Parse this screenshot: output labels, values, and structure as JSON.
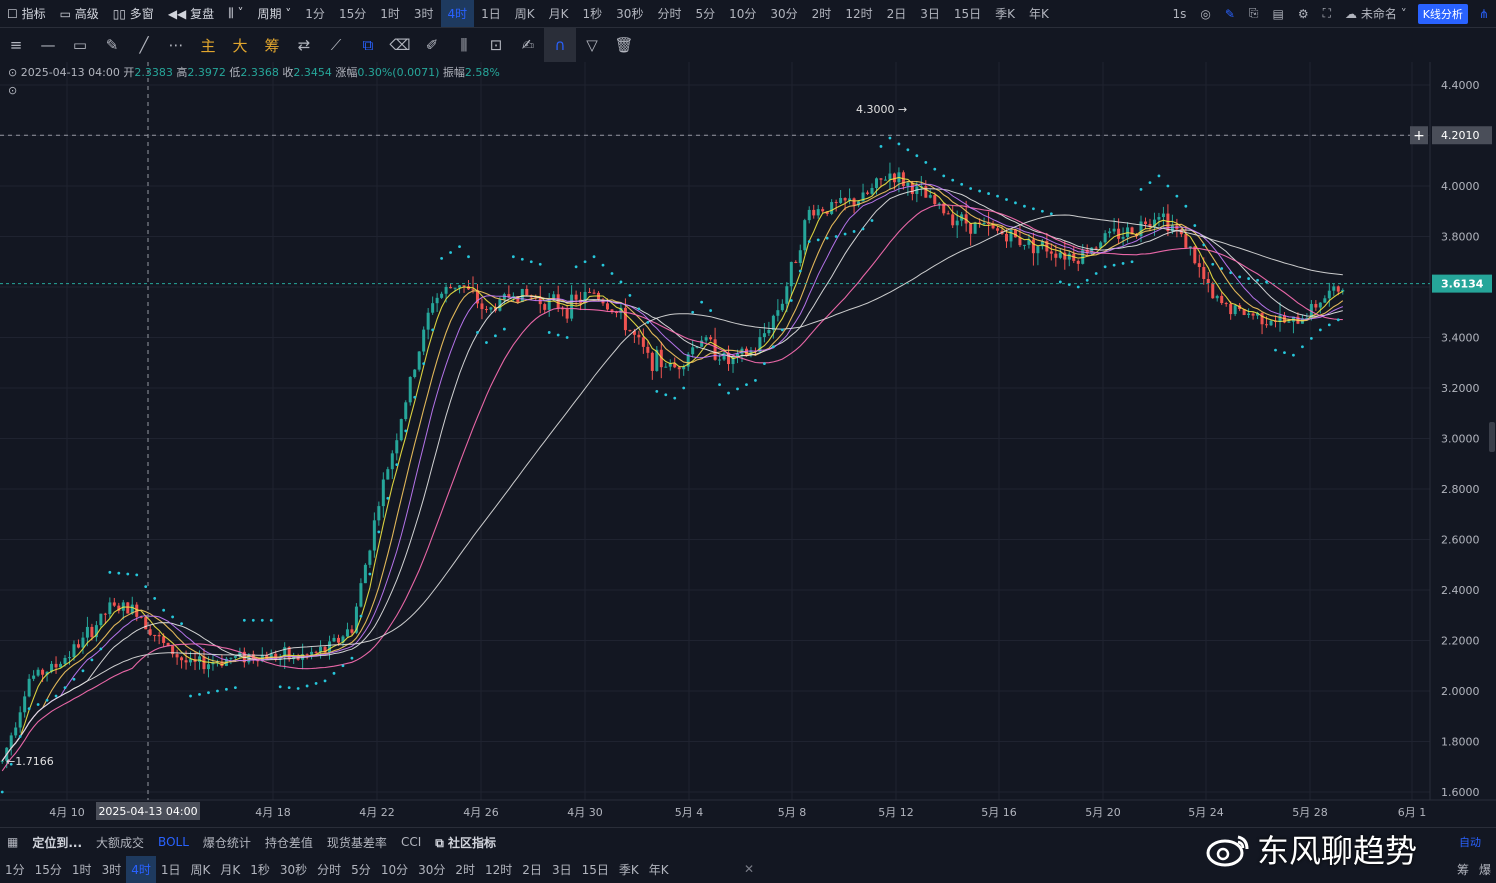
{
  "topbar": {
    "left_buttons": [
      "指标",
      "高级",
      "多窗",
      "复盘"
    ],
    "period_label": "周期",
    "periods": [
      "1分",
      "15分",
      "1时",
      "3时",
      "4时",
      "1日",
      "周K",
      "月K",
      "1秒",
      "30秒",
      "分时",
      "5分",
      "10分",
      "30分",
      "2时",
      "12时",
      "2日",
      "3日",
      "15日",
      "季K",
      "年K"
    ],
    "active_period": "4时",
    "interval": "1s",
    "layout_name": "未命名",
    "analysis_button": "K线分析"
  },
  "toolbar": {
    "cn_tools": [
      "主",
      "大",
      "筹"
    ]
  },
  "legend": {
    "datetime": "2025-04-13 04:00",
    "open_label": "开",
    "open": "2.3383",
    "high_label": "高",
    "high": "2.3972",
    "low_label": "低",
    "low": "2.3368",
    "close_label": "收",
    "close": "2.3454",
    "change_label": "涨幅",
    "change": "0.30%(0.0071)",
    "amp_label": "振幅",
    "amp": "2.58%"
  },
  "chart_data": {
    "type": "candlestick",
    "interval": "4h",
    "y_ticks": [
      "4.4000",
      "4.2000",
      "4.0000",
      "3.8000",
      "3.6000",
      "3.4000",
      "3.2000",
      "3.0000",
      "2.8000",
      "2.6000",
      "2.4000",
      "2.2000",
      "2.0000",
      "1.8000",
      "1.6000"
    ],
    "ylim": [
      1.6,
      4.4
    ],
    "x_ticks": [
      "4月 10",
      "4月 18",
      "4月 22",
      "4月 26",
      "4月 30",
      "5月 4",
      "5月 8",
      "5月 12",
      "5月 16",
      "5月 20",
      "5月 24",
      "5月 28",
      "6月 1"
    ],
    "crosshair_date_label": "2025-04-13 04:00",
    "crosshair_price_label": "4.2010",
    "crosshair_price": 4.201,
    "last_price_label": "3.6134",
    "last_price": 3.6134,
    "high_marker": "4.3000",
    "low_marker": "1.7166",
    "close_path": [
      [
        "4月 9",
        1.72
      ],
      [
        "4月 10",
        2.05
      ],
      [
        "4月 11",
        2.1
      ],
      [
        "4月 12",
        2.2
      ],
      [
        "4月 13",
        2.33
      ],
      [
        "4月 14",
        2.32
      ],
      [
        "4月 15",
        2.18
      ],
      [
        "4月 16",
        2.1
      ],
      [
        "4月 17",
        2.12
      ],
      [
        "4月 18",
        2.14
      ],
      [
        "4月 19",
        2.14
      ],
      [
        "4月 20",
        2.13
      ],
      [
        "4月 21",
        2.16
      ],
      [
        "4月 22",
        2.25
      ],
      [
        "4月 23",
        2.75
      ],
      [
        "4月 24",
        3.15
      ],
      [
        "4月 25",
        3.55
      ],
      [
        "4月 26",
        3.62
      ],
      [
        "4月 27",
        3.5
      ],
      [
        "4月 28",
        3.58
      ],
      [
        "4月 29",
        3.55
      ],
      [
        "4月 30",
        3.52
      ],
      [
        "5月 1",
        3.58
      ],
      [
        "5月 2",
        3.48
      ],
      [
        "5月 3",
        3.32
      ],
      [
        "5月 4",
        3.28
      ],
      [
        "5月 5",
        3.4
      ],
      [
        "5月 6",
        3.3
      ],
      [
        "5月 7",
        3.35
      ],
      [
        "5月 8",
        3.55
      ],
      [
        "5月 9",
        3.9
      ],
      [
        "5月 10",
        3.92
      ],
      [
        "5月 11",
        3.95
      ],
      [
        "5月 12",
        4.05
      ],
      [
        "5月 13",
        3.98
      ],
      [
        "5月 14",
        3.9
      ],
      [
        "5月 15",
        3.85
      ],
      [
        "5月 16",
        3.82
      ],
      [
        "5月 17",
        3.78
      ],
      [
        "5月 18",
        3.75
      ],
      [
        "5月 19",
        3.72
      ],
      [
        "5月 20",
        3.8
      ],
      [
        "5月 21",
        3.82
      ],
      [
        "5月 22",
        3.9
      ],
      [
        "5月 23",
        3.78
      ],
      [
        "5月 24",
        3.55
      ],
      [
        "5月 25",
        3.5
      ],
      [
        "5月 26",
        3.48
      ],
      [
        "5月 27",
        3.45
      ],
      [
        "5月 28",
        3.55
      ],
      [
        "5月 29",
        3.61
      ]
    ]
  },
  "bottom_bar": {
    "items": [
      "定位到...",
      "大额成交",
      "BOLL",
      "爆仓统计",
      "持仓差值",
      "现货基差率",
      "CCI",
      "社区指标"
    ]
  },
  "bottom_periods": [
    "1分",
    "15分",
    "1时",
    "3时",
    "4时",
    "1日",
    "周K",
    "月K",
    "1秒",
    "30秒",
    "分时",
    "5分",
    "10分",
    "30分",
    "2时",
    "12时",
    "2日",
    "3日",
    "15日",
    "季K",
    "年K"
  ],
  "bottom_active": "4时",
  "bottom_right": [
    "筹",
    "爆"
  ],
  "auto_label": "自动",
  "watermark": "东风聊趋势"
}
